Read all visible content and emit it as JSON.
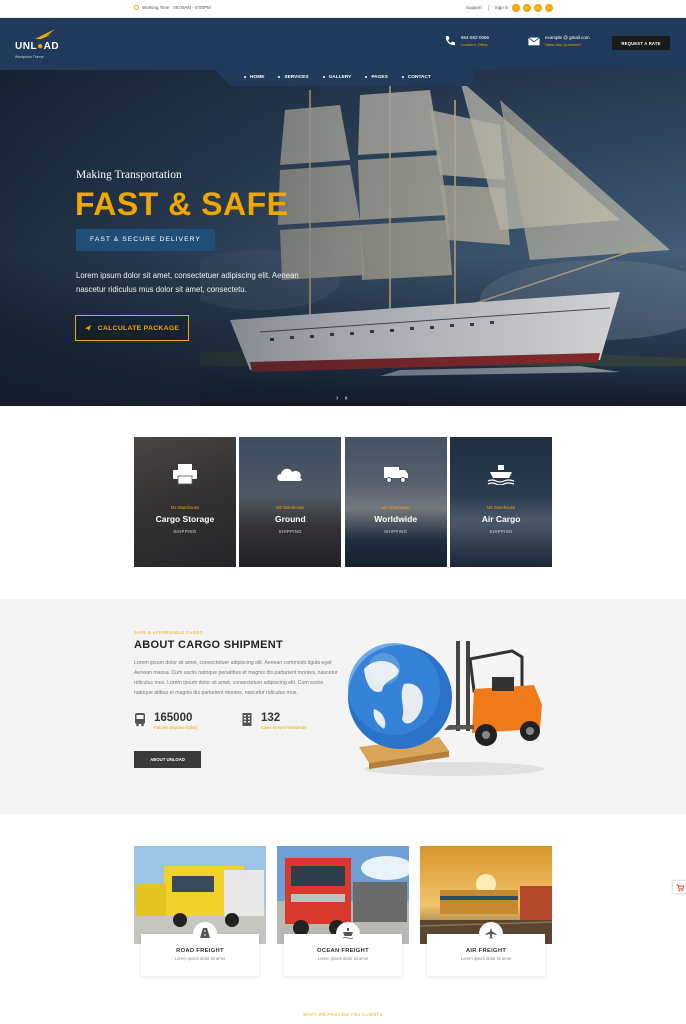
{
  "topbar": {
    "hours": "Working Time : 08:00AM - 9:00PM",
    "support": "Support",
    "sign_in": "Sign in",
    "social": [
      "f",
      "in",
      "in",
      "in"
    ]
  },
  "header": {
    "logo_word_left": "UNL",
    "logo_word_right": "AD",
    "logo_tagline": "Wordpress Theme",
    "phone": "954-562-0066",
    "phone_sub": "Leader's Office",
    "email": "example @ gmail.com",
    "email_sub": "Have Any Question?",
    "request_rate": "REQUEST A RATE"
  },
  "nav": {
    "items": [
      "HOME",
      "SERVICES",
      "GALLERY",
      "PAGES",
      "CONTACT"
    ]
  },
  "hero": {
    "pretitle": "Making Transportation",
    "title": "FAST & SAFE",
    "badge": "FAST & SECURE DELIVERY",
    "paragraph": "Lorem ipsum dolor sit amet, consectetuer adipiscing elit. Aenean nascetur ridiculus mus dolor sit amet, consectetu.",
    "cta": "CALCULATE PACKAGE",
    "next_arrow": "›",
    "pause": "⏸"
  },
  "services": [
    {
      "sub": "M2 Warehouse",
      "title": "Cargo Storage",
      "caption": "SHIPPING",
      "icon": "printer-icon"
    },
    {
      "sub": "M2 Warehouse",
      "title": "Ground",
      "caption": "SHIPPING",
      "icon": "cloud-icon"
    },
    {
      "sub": "M2 Warehouse",
      "title": "Worldwide",
      "caption": "SHIPPING",
      "icon": "truck-icon"
    },
    {
      "sub": "M2 Warehouse",
      "title": "Air Cargo",
      "caption": "SHIPPING",
      "icon": "ship-icon"
    }
  ],
  "about": {
    "eyebrow": "SAFE & AFFORDABLE CARGO",
    "title": "ABOUT CARGO SHIPMENT",
    "body": "Lorem ipsum dolor sit amet, consectetuer adipiscing elit. Aenean commodo ligula eget Aenean massa. Cum sociis natoque penatibus et magnis dis parturient montes, nascetur ridiculus mus. Lorem ipsum dolor sit amet, consectetuer adipiscing elit. Cum sociis natoque atibus et magnis dis parturient montes, nascetur ridiculus mus.",
    "stats": [
      {
        "number": "165000",
        "label": "Parcels Shipped Safely"
      },
      {
        "number": "132",
        "label": "Cities Served Worldwide"
      }
    ],
    "button": "ABOUT UNLOAD"
  },
  "freight": [
    {
      "title": "ROAD FREIGHT",
      "sub": "Lorem ipsum dolor sit amet"
    },
    {
      "title": "OCEAN FREIGHT",
      "sub": "Lorem ipsum dolor sit amet"
    },
    {
      "title": "AIR FREIGHT",
      "sub": "Lorem ipsum dolor sit amet"
    }
  ],
  "bottom": {
    "eyebrow": "WHAT WE PROVIDE YOU CLIENTS"
  },
  "colors": {
    "accent": "#f2a600",
    "navy": "#1f3a5a",
    "badge_blue": "#1f4e79"
  }
}
